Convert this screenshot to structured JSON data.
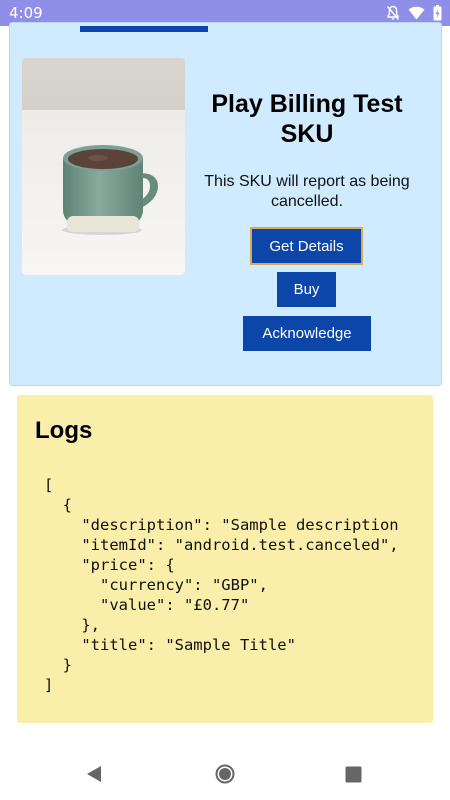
{
  "status_bar": {
    "time": "4:09",
    "icons": [
      "notifications-off-icon",
      "wifi-icon",
      "battery-icon"
    ]
  },
  "product": {
    "title": "Play Billing Test SKU",
    "description": "This SKU will report as being cancelled.",
    "image": "coffee-mug-image",
    "buttons": {
      "get_details": "Get Details",
      "buy": "Buy",
      "acknowledge": "Acknowledge"
    }
  },
  "logs": {
    "title": "Logs",
    "content": "[\n  {\n    \"description\": \"Sample description\n    \"itemId\": \"android.test.canceled\",\n    \"price\": {\n      \"currency\": \"GBP\",\n      \"value\": \"£0.77\"\n    },\n    \"title\": \"Sample Title\"\n  }\n]"
  },
  "nav_bar": {
    "icons": [
      "back-icon",
      "home-icon",
      "recents-icon"
    ]
  },
  "colors": {
    "status_bar": "#8f8fe8",
    "product_card": "#d0ebff",
    "button": "#0b46a8",
    "logs_card": "#f9efaa"
  }
}
